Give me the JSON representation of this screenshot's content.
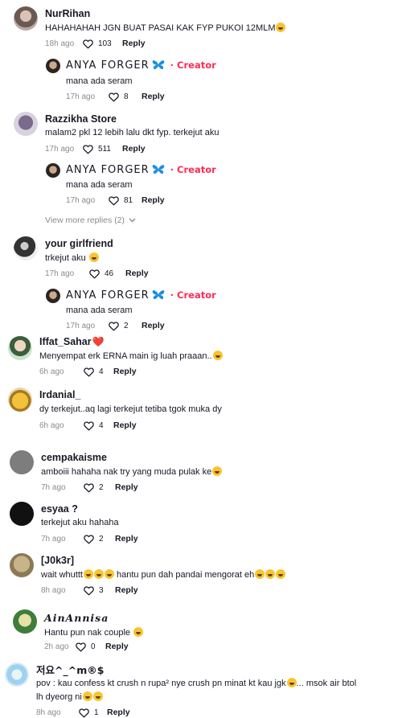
{
  "comments": [
    {
      "user": "NurRihan",
      "text": "HAHAHAHAH JGN BUAT PASAI KAK FYP PUKOI 12MLM",
      "time": "18h ago",
      "likes": "103",
      "reply": "Reply"
    },
    {
      "user": "ANYA FORGER",
      "creator": "Creator",
      "text": "mana ada seram",
      "time": "17h ago",
      "likes": "8",
      "reply": "Reply"
    },
    {
      "user": "Razzikha Store",
      "text": "malam2 pkl 12 lebih lalu dkt fyp. terkejut aku",
      "time": "17h ago",
      "likes": "511",
      "reply": "Reply"
    },
    {
      "user": "ANYA FORGER",
      "creator": "Creator",
      "text": "mana ada seram",
      "time": "17h ago",
      "likes": "81",
      "reply": "Reply"
    },
    {
      "user": "your girlfriend",
      "text": "trkejut aku",
      "time": "17h ago",
      "likes": "46",
      "reply": "Reply"
    },
    {
      "user": "ANYA FORGER",
      "creator": "Creator",
      "text": "mana ada seram",
      "time": "17h ago",
      "likes": "2",
      "reply": "Reply"
    },
    {
      "user": "Iffat_Sahar",
      "text": "Menyempat erk ERNA main ig luah praaan..",
      "time": "6h ago",
      "likes": "4",
      "reply": "Reply"
    },
    {
      "user": "Irdanial_",
      "text": "dy terkejut..aq lagi terkejut tetiba tgok muka dy",
      "time": "6h ago",
      "likes": "4",
      "reply": "Reply"
    },
    {
      "user": "cempakaisme",
      "text": "amboiii hahaha nak try yang muda pulak ke",
      "time": "7h ago",
      "likes": "2",
      "reply": "Reply"
    },
    {
      "user": "esyaa ?",
      "text": "terkejut aku hahaha",
      "time": "7h ago",
      "likes": "2",
      "reply": "Reply"
    },
    {
      "user": "[J0k3r]",
      "text_a": "wait whuttt",
      "text_b": " hantu pun dah pandai mengorat eh",
      "time": "8h ago",
      "likes": "3",
      "reply": "Reply"
    },
    {
      "user": "𝑨𝒊𝒏𝑨𝒏𝒏𝒊𝒔𝒂",
      "text": "Hantu pun nak couple",
      "time": "2h ago",
      "likes": "0",
      "reply": "Reply"
    },
    {
      "user": "저요^_^m®$",
      "text_a": "pov : kau confess kt crush n rupa² nye crush pn minat kt kau jgk",
      "text_b": "... msok air btol",
      "text_c": "lh dyeorg ni",
      "time": "8h ago",
      "likes": "1",
      "reply": "Reply"
    }
  ],
  "view_more": "View more replies (2)",
  "colors": {
    "accent": "#fe2c55",
    "muted": "#8a8b91",
    "text": "#161823",
    "creator_badge": "#1877f2"
  },
  "icons": [
    "heart-outline-icon",
    "butterfly-icon",
    "chevron-down-icon",
    "laughing-emoji-icon",
    "crying-emoji-icon",
    "red-heart-icon"
  ]
}
